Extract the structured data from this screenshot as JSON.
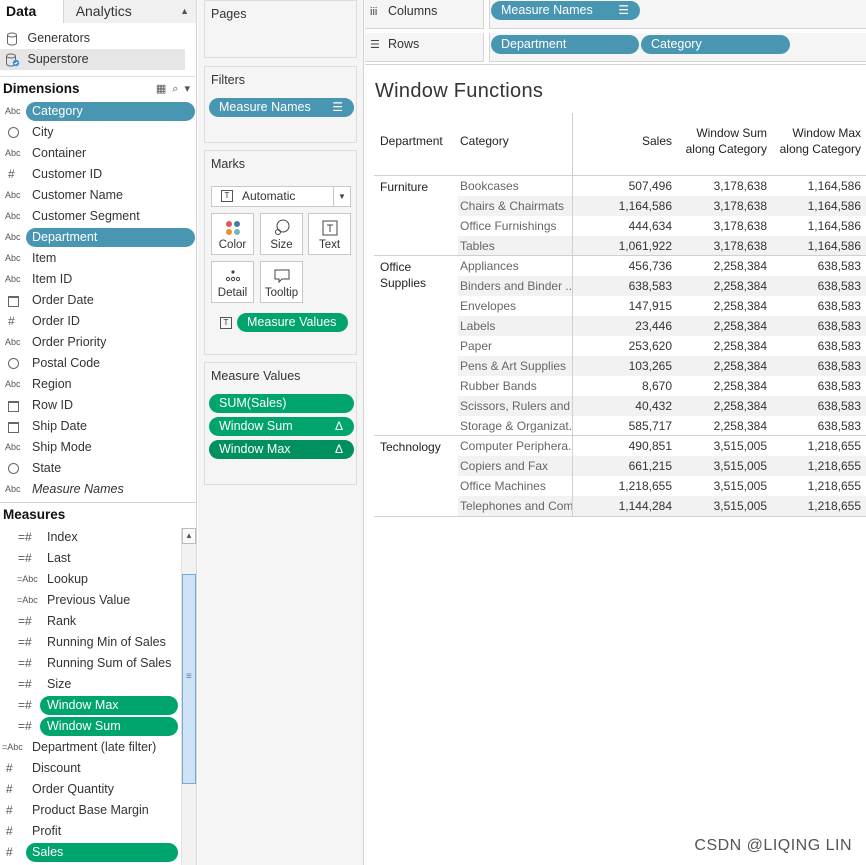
{
  "pane": {
    "tab_data": "Data",
    "tab_analytics": "Analytics",
    "datasources": [
      "Generators",
      "Superstore"
    ]
  },
  "dimensions": {
    "title": "Dimensions",
    "fields": [
      {
        "type": "Abc",
        "label": "Category",
        "pill": true
      },
      {
        "type": "globe",
        "label": "City"
      },
      {
        "type": "Abc",
        "label": "Container"
      },
      {
        "type": "#",
        "label": "Customer ID"
      },
      {
        "type": "Abc",
        "label": "Customer Name"
      },
      {
        "type": "Abc",
        "label": "Customer Segment"
      },
      {
        "type": "Abc",
        "label": "Department",
        "pill": true
      },
      {
        "type": "Abc",
        "label": "Item"
      },
      {
        "type": "Abc",
        "label": "Item ID"
      },
      {
        "type": "cal",
        "label": "Order Date"
      },
      {
        "type": "#",
        "label": "Order ID"
      },
      {
        "type": "Abc",
        "label": "Order Priority"
      },
      {
        "type": "globe",
        "label": "Postal Code"
      },
      {
        "type": "Abc",
        "label": "Region"
      },
      {
        "type": "cal",
        "label": "Row ID"
      },
      {
        "type": "cal",
        "label": "Ship Date"
      },
      {
        "type": "Abc",
        "label": "Ship Mode"
      },
      {
        "type": "globe",
        "label": "State"
      },
      {
        "type": "Abc",
        "label": "Measure Names",
        "italic": true
      }
    ]
  },
  "measures": {
    "title": "Measures",
    "calc_fields": [
      {
        "type": "=#",
        "label": "Index"
      },
      {
        "type": "=#",
        "label": "Last"
      },
      {
        "type": "=Abc",
        "label": "Lookup"
      },
      {
        "type": "=Abc",
        "label": "Previous Value"
      },
      {
        "type": "=#",
        "label": "Rank"
      },
      {
        "type": "=#",
        "label": "Running Min of Sales"
      },
      {
        "type": "=#",
        "label": "Running Sum of Sales"
      },
      {
        "type": "=#",
        "label": "Size"
      },
      {
        "type": "=#",
        "label": "Window Max",
        "pill": true
      },
      {
        "type": "=#",
        "label": "Window Sum",
        "pill": true
      }
    ],
    "fields": [
      {
        "type": "=Abc",
        "label": "Department (late filter)"
      },
      {
        "type": "#",
        "label": "Discount"
      },
      {
        "type": "#",
        "label": "Order Quantity"
      },
      {
        "type": "#",
        "label": "Product Base Margin"
      },
      {
        "type": "#",
        "label": "Profit"
      },
      {
        "type": "#",
        "label": "Sales",
        "pill": true
      }
    ]
  },
  "cards": {
    "pages_title": "Pages",
    "filters_title": "Filters",
    "filter_pill": "Measure Names",
    "marks_title": "Marks",
    "mark_type": "Automatic",
    "mark_buttons": [
      "Color",
      "Size",
      "Text",
      "Detail",
      "Tooltip"
    ],
    "marks_pill": "Measure Values",
    "measure_values_title": "Measure Values",
    "measure_values_pills": [
      "SUM(Sales)",
      "Window Sum",
      "Window Max"
    ],
    "delta_glyph": "Δ"
  },
  "shelves": {
    "columns_label": "Columns",
    "columns_pills": [
      "Measure Names"
    ],
    "rows_label": "Rows",
    "rows_pills": [
      "Department",
      "Category"
    ]
  },
  "view": {
    "title": "Window Functions",
    "headers": {
      "department": "Department",
      "category": "Category",
      "sales": "Sales",
      "window_sum_1": "Window Sum",
      "window_sum_2": "along Category",
      "window_max_1": "Window Max",
      "window_max_2": "along Category"
    },
    "groups": [
      {
        "dept_lines": [
          "Furniture"
        ],
        "rows": [
          {
            "category": "Bookcases",
            "sales": "507,496",
            "wsum": "3,178,638",
            "wmax": "1,164,586"
          },
          {
            "category": "Chairs & Chairmats",
            "sales": "1,164,586",
            "wsum": "3,178,638",
            "wmax": "1,164,586"
          },
          {
            "category": "Office Furnishings",
            "sales": "444,634",
            "wsum": "3,178,638",
            "wmax": "1,164,586"
          },
          {
            "category": "Tables",
            "sales": "1,061,922",
            "wsum": "3,178,638",
            "wmax": "1,164,586"
          }
        ]
      },
      {
        "dept_lines": [
          "Office",
          "Supplies"
        ],
        "rows": [
          {
            "category": "Appliances",
            "sales": "456,736",
            "wsum": "2,258,384",
            "wmax": "638,583"
          },
          {
            "category": "Binders and Binder ..",
            "sales": "638,583",
            "wsum": "2,258,384",
            "wmax": "638,583"
          },
          {
            "category": "Envelopes",
            "sales": "147,915",
            "wsum": "2,258,384",
            "wmax": "638,583"
          },
          {
            "category": "Labels",
            "sales": "23,446",
            "wsum": "2,258,384",
            "wmax": "638,583"
          },
          {
            "category": "Paper",
            "sales": "253,620",
            "wsum": "2,258,384",
            "wmax": "638,583"
          },
          {
            "category": "Pens & Art Supplies",
            "sales": "103,265",
            "wsum": "2,258,384",
            "wmax": "638,583"
          },
          {
            "category": "Rubber Bands",
            "sales": "8,670",
            "wsum": "2,258,384",
            "wmax": "638,583"
          },
          {
            "category": "Scissors, Rulers and ..",
            "sales": "40,432",
            "wsum": "2,258,384",
            "wmax": "638,583"
          },
          {
            "category": "Storage & Organizat..",
            "sales": "585,717",
            "wsum": "2,258,384",
            "wmax": "638,583"
          }
        ]
      },
      {
        "dept_lines": [
          "Technology"
        ],
        "rows": [
          {
            "category": "Computer Periphera..",
            "sales": "490,851",
            "wsum": "3,515,005",
            "wmax": "1,218,655"
          },
          {
            "category": "Copiers and Fax",
            "sales": "661,215",
            "wsum": "3,515,005",
            "wmax": "1,218,655"
          },
          {
            "category": "Office Machines",
            "sales": "1,218,655",
            "wsum": "3,515,005",
            "wmax": "1,218,655"
          },
          {
            "category": "Telephones and Com..",
            "sales": "1,144,284",
            "wsum": "3,515,005",
            "wmax": "1,218,655"
          }
        ]
      }
    ]
  },
  "watermark": "CSDN @LIQING LIN",
  "colors": {
    "dimension_pill": "#4996b2",
    "measure_pill": "#00a46d",
    "band": "#f2f2f2"
  }
}
